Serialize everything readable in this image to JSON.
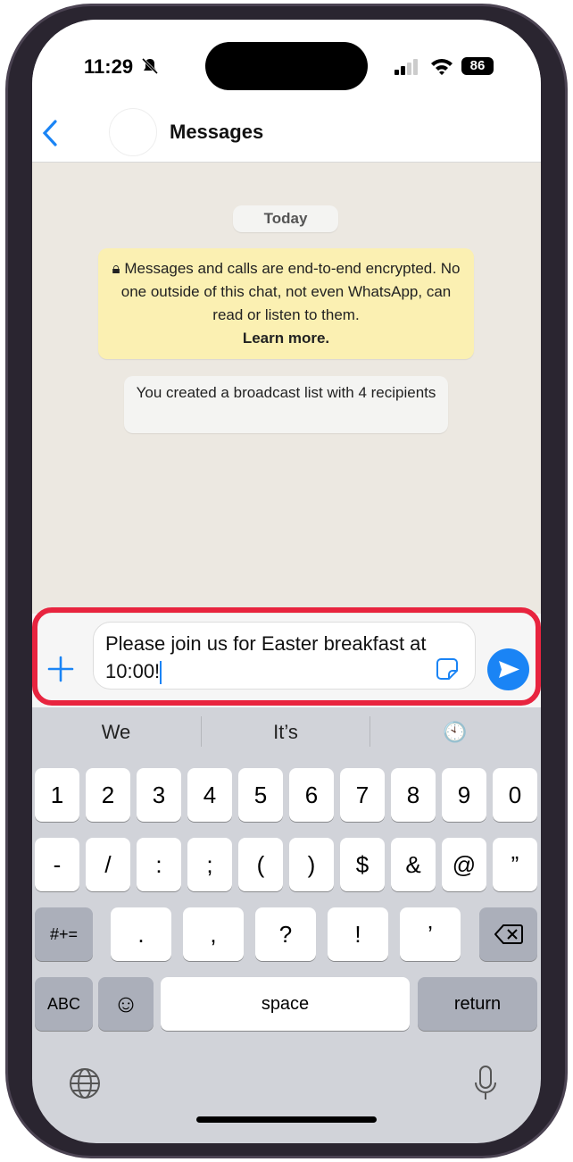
{
  "status_bar": {
    "time": "11:29",
    "battery": "86",
    "icons": [
      "bell-slash-icon",
      "signal-icon",
      "wifi-icon",
      "battery-icon"
    ]
  },
  "header": {
    "title": "Messages",
    "back_icon": "chevron-left-icon"
  },
  "chat": {
    "date": "Today",
    "encryption_notice": "Messages and calls are end-to-end encrypted. No one outside of this chat, not even WhatsApp, can read or listen to them.",
    "learn_more": "Learn more.",
    "system_message": "You created a broadcast list with 4 recipients"
  },
  "composer": {
    "text": "Please join us for Easter breakfast at 10:00!",
    "highlight_color": "#e8243f",
    "accent": "#1a84f5"
  },
  "suggestions": [
    "We",
    "It’s"
  ],
  "keyboard": {
    "row1": [
      "1",
      "2",
      "3",
      "4",
      "5",
      "6",
      "7",
      "8",
      "9",
      "0"
    ],
    "row2": [
      "-",
      "/",
      ":",
      ";",
      "(",
      ")",
      "$",
      "&",
      "@",
      "”"
    ],
    "row3_left": "#+=",
    "row3": [
      ".",
      ",",
      "?",
      "!",
      "’"
    ],
    "row4": {
      "abc": "ABC",
      "space": "space",
      "return": "return"
    }
  }
}
